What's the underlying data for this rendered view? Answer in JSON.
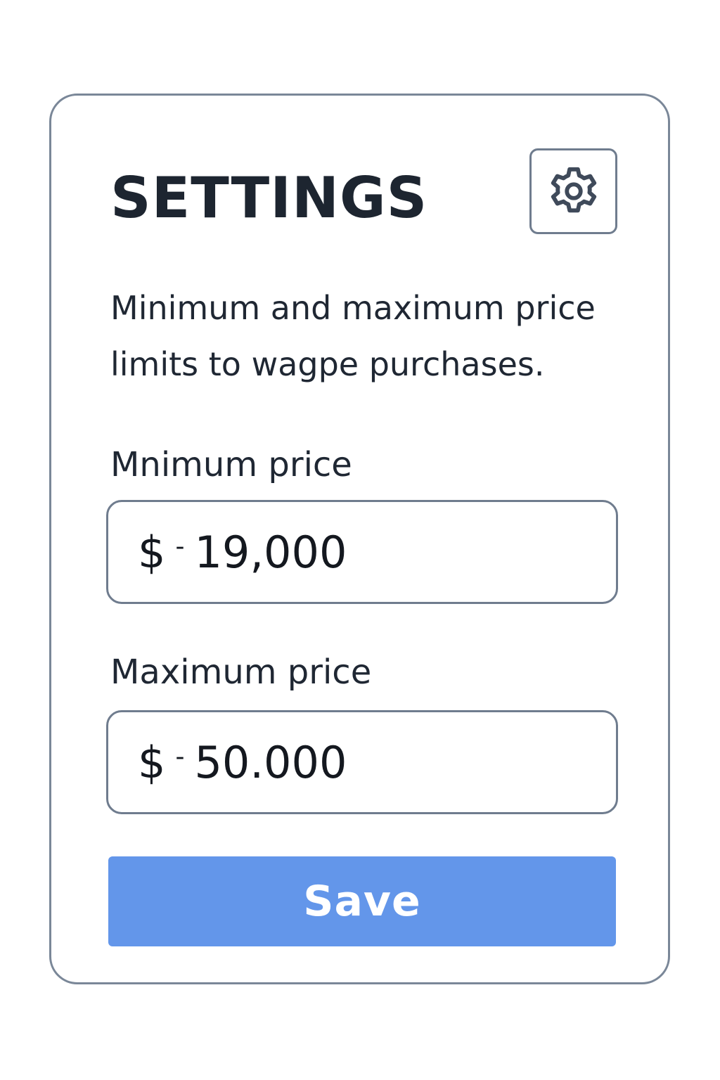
{
  "settings": {
    "title": "SETTINGS",
    "gear_icon": "gear-icon",
    "description": "Minimum and maximum price limits to wagpe purchases.",
    "min": {
      "label": "Mnimum price",
      "currency": "$",
      "dash": "-",
      "value": "19,000"
    },
    "max": {
      "label": "Maximum price",
      "currency": "$",
      "dash": "-",
      "value": "50.000"
    },
    "save_label": "Save"
  },
  "colors": {
    "border": "#7a8798",
    "accent": "#6396ea",
    "text": "#1d2530"
  }
}
